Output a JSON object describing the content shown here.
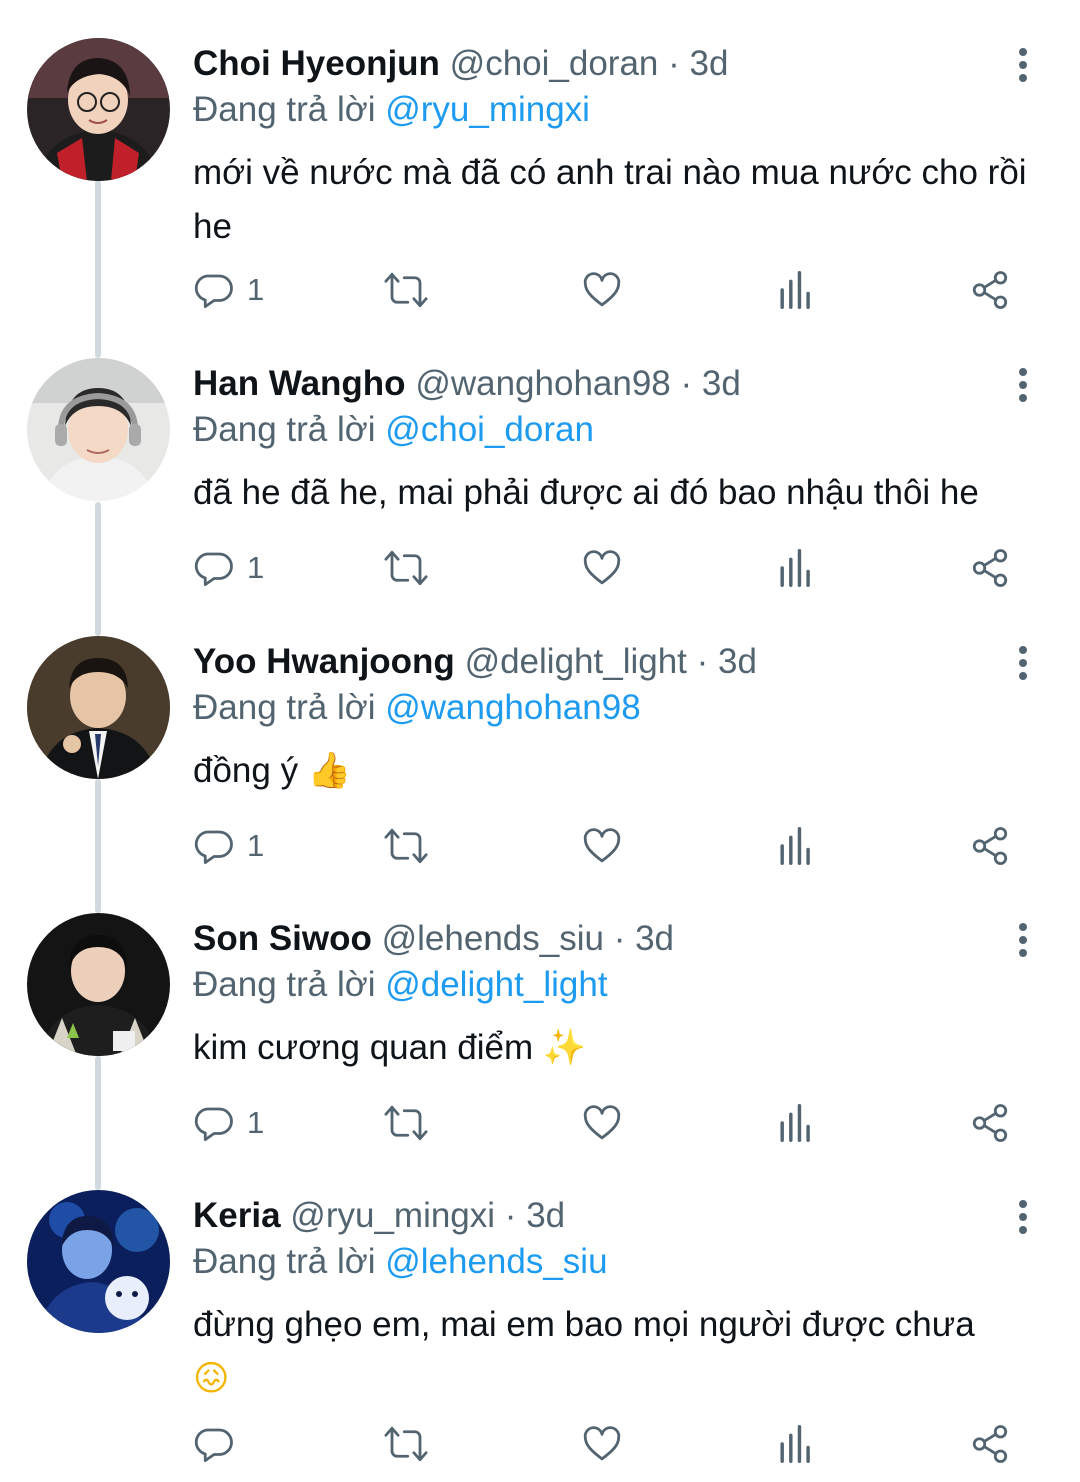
{
  "reply_prefix": "Đang trả lời",
  "dot": "·",
  "colors": {
    "text": "#0f1419",
    "secondary": "#536471",
    "link": "#1d9bf0",
    "thread_line": "#cfd9de"
  },
  "tweets": [
    {
      "name": "Choi Hyeonjun",
      "handle": "@choi_doran",
      "time": "3d",
      "reply_to": "@ryu_mingxi",
      "text": "mới về nước mà đã có anh trai nào mua nước cho rồi he",
      "emoji": "",
      "reply_count": "1"
    },
    {
      "name": "Han Wangho",
      "handle": "@wanghohan98",
      "time": "3d",
      "reply_to": "@choi_doran",
      "text": "đã he đã he, mai phải được ai đó bao nhậu thôi he",
      "emoji": "",
      "reply_count": "1"
    },
    {
      "name": "Yoo Hwanjoong",
      "handle": "@delight_light",
      "time": "3d",
      "reply_to": "@wanghohan98",
      "text": "đồng ý",
      "emoji": "👍",
      "reply_count": "1"
    },
    {
      "name": "Son Siwoo",
      "handle": "@lehends_siu",
      "time": "3d",
      "reply_to": "@delight_light",
      "text": "kim cương quan điểm",
      "emoji": "✨",
      "reply_count": "1"
    },
    {
      "name": "Keria",
      "handle": "@ryu_mingxi",
      "time": "3d",
      "reply_to": "@lehends_siu",
      "text": "đừng ghẹo em, mai em bao mọi người được chưa",
      "emoji": "😖",
      "reply_count": ""
    }
  ],
  "icons": [
    "reply-icon",
    "retweet-icon",
    "like-icon",
    "analytics-icon",
    "share-icon",
    "more-icon"
  ]
}
